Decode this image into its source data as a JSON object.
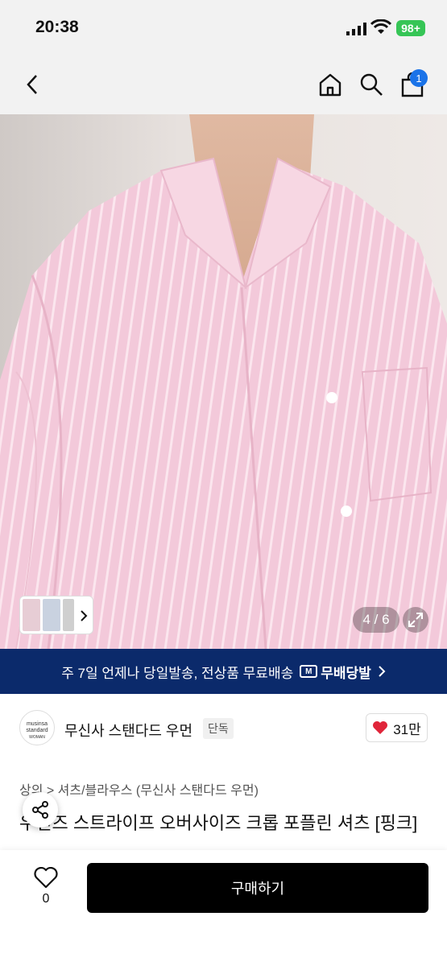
{
  "status": {
    "time": "20:38",
    "battery": "98+"
  },
  "nav": {
    "cart_count": "1"
  },
  "gallery": {
    "counter": "4 / 6"
  },
  "banner": {
    "text": "주 7일 언제나 당일발송, 전상품 무료배송",
    "badge_text": "무배당발"
  },
  "brand": {
    "logo_line1": "musinsa",
    "logo_line2": "standard",
    "logo_line3": "WOMAN",
    "name": "무신사 스탠다드 우먼",
    "tag": "단독",
    "likes": "31만"
  },
  "product": {
    "breadcrumb": "상의 > 셔츠/블라우스 (무신사 스탠다드 우먼)",
    "title": "우먼즈 스트라이프 오버사이즈 크롭 포플린 셔츠 [핑크]"
  },
  "bottom": {
    "like_count": "0",
    "buy_label": "구매하기"
  },
  "colors": {
    "banner_bg": "#0b2a6b",
    "battery": "#36c556",
    "heart": "#e0253a",
    "cart_badge": "#1a73e8"
  }
}
